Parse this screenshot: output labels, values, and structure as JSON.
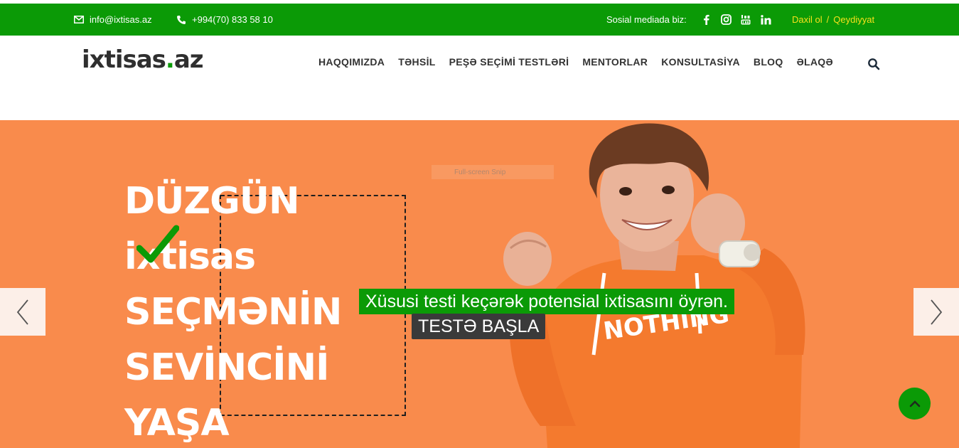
{
  "topbar": {
    "email": "info@ixtisas.az",
    "phone": "+994(70) 833 58 10",
    "social_label": "Sosial mediada biz:",
    "social_icons": [
      "facebook-icon",
      "instagram-icon",
      "youtube-icon",
      "linkedin-icon"
    ],
    "login": "Daxil ol",
    "separator": "/",
    "register": "Qeydiyyat",
    "colors": {
      "bar": "#0b9a06",
      "auth": "#f6e11b"
    }
  },
  "header": {
    "logo_main": "ixtisas",
    "logo_dot": ".",
    "logo_tld": "az",
    "nav": [
      "HAQQIMIZDA",
      "TƏHSİL",
      "PEŞƏ SEÇİMİ TESTLƏRİ",
      "MENTORLAR",
      "KONSULTASİYA",
      "BLOQ",
      "ƏLAQƏ"
    ]
  },
  "hero": {
    "headline": [
      "DÜZGÜN",
      "ixtisas",
      "SEÇMƏNİN",
      "SEVİNCİNİ",
      "YAŞA"
    ],
    "snip_label": "Full-screen Snip",
    "caption": "Xüsusi testi keçərək potensial ixtisasını öyrən.",
    "cta": "TESTƏ BAŞLA",
    "colors": {
      "background": "#f98b4c",
      "caption": "#0b9a06",
      "cta": "#3a3a3a"
    }
  }
}
